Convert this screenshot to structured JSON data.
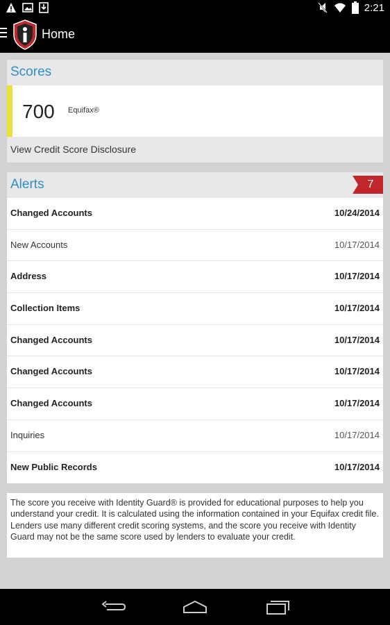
{
  "status_bar": {
    "time": "2:21",
    "left_icons": [
      "warning-icon",
      "image-icon",
      "download-icon"
    ],
    "right_icons": [
      "mute-icon",
      "wifi-icon",
      "battery-icon"
    ]
  },
  "app_bar": {
    "title": "Home",
    "logo": "identity-guard-logo",
    "menu_icon": "menu-icon"
  },
  "scores": {
    "title": "Scores",
    "score_value": "700",
    "bureau": "Equifax®",
    "indicator_color": "#e8e23c",
    "disclosure_link": "View Credit Score Disclosure"
  },
  "alerts": {
    "title": "Alerts",
    "badge_count": "7",
    "badge_color": "#c0272d",
    "items": [
      {
        "name": "Changed Accounts",
        "date": "10/24/2014",
        "unread": true
      },
      {
        "name": "New Accounts",
        "date": "10/17/2014",
        "unread": false
      },
      {
        "name": "Address",
        "date": "10/17/2014",
        "unread": true
      },
      {
        "name": "Collection Items",
        "date": "10/17/2014",
        "unread": true
      },
      {
        "name": "Changed Accounts",
        "date": "10/17/2014",
        "unread": true
      },
      {
        "name": "Changed Accounts",
        "date": "10/17/2014",
        "unread": true
      },
      {
        "name": "Changed Accounts",
        "date": "10/17/2014",
        "unread": true
      },
      {
        "name": "Inquiries",
        "date": "10/17/2014",
        "unread": false
      },
      {
        "name": "New Public Records",
        "date": "10/17/2014",
        "unread": true
      }
    ]
  },
  "disclaimer": "The score you receive with Identity Guard® is provided for educational purposes to help you understand your credit. It is calculated using the information contained in your Equifax credit file. Lenders use many different credit scoring systems, and the score you receive with Identity Guard may not be the same score used by lenders to evaluate your credit.",
  "nav_bar": {
    "buttons": [
      "back-icon",
      "home-icon",
      "recents-icon"
    ]
  },
  "colors": {
    "accent": "#2f8fc9",
    "background": "#d2d2d2"
  }
}
